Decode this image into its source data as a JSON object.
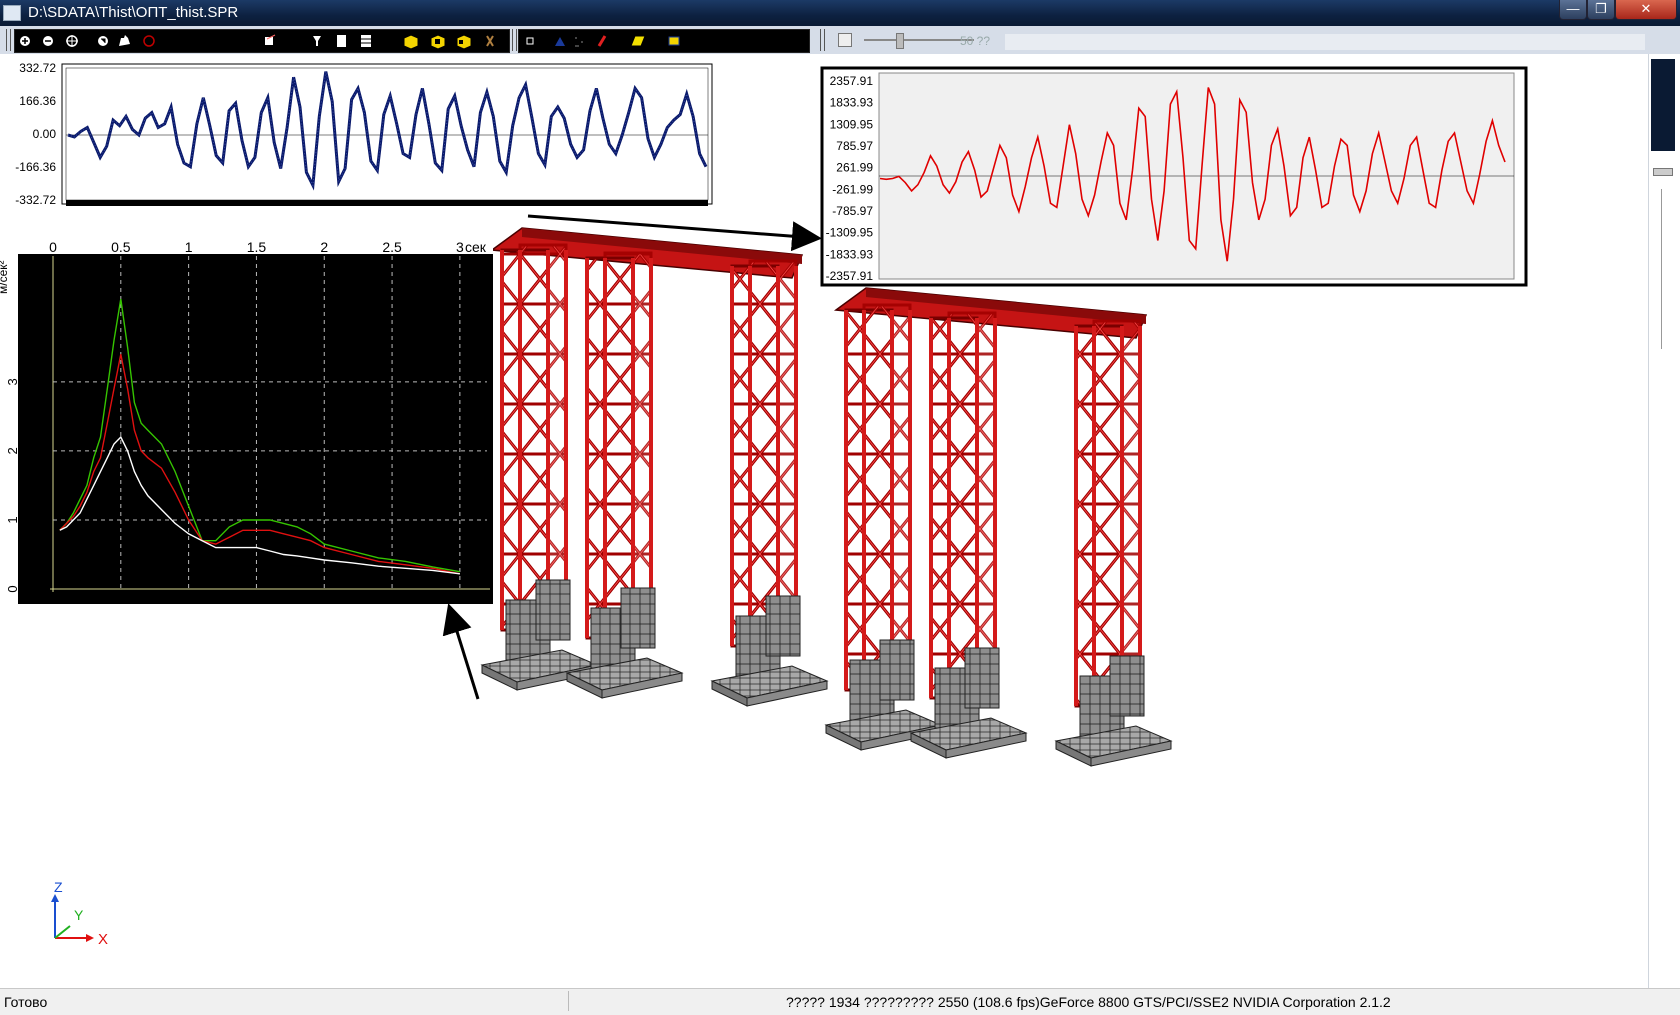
{
  "window": {
    "title": "D:\\SDATA\\Thist\\ОПТ_thist.SPR",
    "buttons": {
      "minimize": "—",
      "restore": "❐",
      "close": "✕"
    }
  },
  "toolbar": {
    "frame_value": "50 ??"
  },
  "chart_data": [
    {
      "type": "line",
      "title": "",
      "yticks": [
        "332.72",
        "166.36",
        "0.00",
        "-166.36",
        "-332.72"
      ],
      "ylim": [
        -332.72,
        332.72
      ],
      "series": [
        {
          "color": "#0a1a6b",
          "values": [
            0,
            -10,
            20,
            40,
            -40,
            -120,
            -60,
            80,
            50,
            100,
            30,
            0,
            90,
            120,
            40,
            60,
            150,
            -50,
            -150,
            -170,
            60,
            200,
            50,
            -110,
            -150,
            130,
            170,
            -30,
            -170,
            -120,
            120,
            200,
            -40,
            -180,
            40,
            310,
            150,
            -200,
            -270,
            100,
            340,
            180,
            -250,
            -180,
            190,
            250,
            120,
            -140,
            -190,
            110,
            210,
            60,
            -100,
            -120,
            110,
            250,
            60,
            -150,
            -190,
            140,
            210,
            50,
            -80,
            -170,
            120,
            230,
            100,
            -140,
            -200,
            50,
            200,
            270,
            90,
            -100,
            -160,
            100,
            150,
            90,
            -50,
            -120,
            -80,
            130,
            250,
            90,
            -50,
            -100,
            0,
            120,
            250,
            200,
            -20,
            -120,
            -50,
            40,
            80,
            110,
            220,
            100,
            -100,
            -170
          ]
        }
      ]
    },
    {
      "type": "line",
      "title": "",
      "yticks": [
        "2357.91",
        "1833.93",
        "1309.95",
        "785.97",
        "261.99",
        "-261.99",
        "-785.97",
        "-1309.95",
        "-1833.93",
        "-2357.91"
      ],
      "ylim": [
        -2357.91,
        2357.91
      ],
      "series": [
        {
          "color": "#e00000",
          "values": [
            0,
            -20,
            0,
            50,
            -100,
            -300,
            -150,
            150,
            550,
            300,
            -150,
            -350,
            -80,
            400,
            650,
            200,
            -450,
            -300,
            250,
            800,
            500,
            -400,
            -800,
            -200,
            500,
            1000,
            300,
            -600,
            -700,
            300,
            1300,
            600,
            -500,
            -900,
            -400,
            400,
            1100,
            800,
            -600,
            -1000,
            200,
            1700,
            1500,
            -500,
            -1500,
            -300,
            1800,
            2100,
            500,
            -1500,
            -1700,
            300,
            2200,
            1800,
            -1000,
            -2000,
            -500,
            1900,
            1600,
            -100,
            -1000,
            -500,
            800,
            1200,
            300,
            -900,
            -700,
            500,
            1000,
            200,
            -700,
            -600,
            300,
            950,
            800,
            -400,
            -800,
            -300,
            600,
            1100,
            400,
            -300,
            -600,
            0,
            800,
            1000,
            200,
            -600,
            -700,
            200,
            900,
            1100,
            400,
            -300,
            -600,
            100,
            900,
            1400,
            800,
            400
          ]
        }
      ]
    },
    {
      "type": "line",
      "title": "",
      "xlabel": "сек",
      "ylabel": "м/сек²",
      "xticks": [
        "0",
        "0.5",
        "1",
        "1.5",
        "2",
        "2.5",
        "3"
      ],
      "yticks": [
        "0",
        "1",
        "2",
        "3"
      ],
      "xlim": [
        0,
        3.2
      ],
      "ylim": [
        0,
        4.2
      ],
      "grid": true,
      "series": [
        {
          "color": "#35c400",
          "x": [
            0.05,
            0.1,
            0.15,
            0.2,
            0.25,
            0.3,
            0.35,
            0.4,
            0.45,
            0.5,
            0.55,
            0.6,
            0.65,
            0.7,
            0.8,
            0.9,
            1.0,
            1.1,
            1.2,
            1.3,
            1.4,
            1.5,
            1.6,
            1.7,
            1.8,
            1.9,
            2.0,
            2.2,
            2.4,
            2.6,
            2.8,
            3.0
          ],
          "y": [
            0.85,
            0.95,
            1.1,
            1.3,
            1.5,
            1.9,
            2.2,
            2.9,
            3.6,
            4.2,
            3.5,
            2.7,
            2.4,
            2.3,
            2.1,
            1.7,
            1.2,
            0.7,
            0.7,
            0.9,
            1.0,
            1.0,
            1.0,
            0.95,
            0.9,
            0.8,
            0.65,
            0.55,
            0.45,
            0.4,
            0.32,
            0.25
          ]
        },
        {
          "color": "#e01010",
          "x": [
            0.05,
            0.1,
            0.15,
            0.2,
            0.25,
            0.3,
            0.35,
            0.4,
            0.45,
            0.5,
            0.55,
            0.6,
            0.65,
            0.7,
            0.8,
            0.9,
            1.0,
            1.1,
            1.2,
            1.3,
            1.4,
            1.5,
            1.6,
            1.7,
            1.8,
            1.9,
            2.0,
            2.2,
            2.4,
            2.6,
            2.8,
            3.0
          ],
          "y": [
            0.85,
            0.95,
            1.05,
            1.2,
            1.4,
            1.7,
            1.9,
            2.4,
            2.9,
            3.4,
            2.9,
            2.3,
            2.0,
            1.9,
            1.75,
            1.4,
            1.0,
            0.7,
            0.65,
            0.75,
            0.85,
            0.85,
            0.85,
            0.8,
            0.75,
            0.7,
            0.6,
            0.5,
            0.4,
            0.35,
            0.3,
            0.22
          ]
        },
        {
          "color": "#ffffff",
          "x": [
            0.05,
            0.1,
            0.15,
            0.2,
            0.25,
            0.3,
            0.35,
            0.4,
            0.45,
            0.5,
            0.55,
            0.6,
            0.65,
            0.7,
            0.8,
            0.9,
            1.0,
            1.1,
            1.2,
            1.3,
            1.4,
            1.5,
            1.6,
            1.7,
            1.8,
            1.9,
            2.0,
            2.2,
            2.4,
            2.6,
            2.8,
            3.0
          ],
          "y": [
            0.85,
            0.9,
            1.0,
            1.1,
            1.3,
            1.5,
            1.7,
            1.9,
            2.1,
            2.2,
            2.0,
            1.7,
            1.5,
            1.35,
            1.15,
            0.95,
            0.8,
            0.7,
            0.6,
            0.6,
            0.6,
            0.6,
            0.55,
            0.5,
            0.48,
            0.45,
            0.42,
            0.38,
            0.33,
            0.3,
            0.27,
            0.22
          ]
        }
      ]
    }
  ],
  "axes_triad": {
    "x": "X",
    "y": "Y",
    "z": "Z"
  },
  "status": {
    "ready": "Готово",
    "info": "????? 1934  ????????? 2550  (108.6 fps)GeForce 8800 GTS/PCI/SSE2 NVIDIA Corporation 2.1.2"
  }
}
